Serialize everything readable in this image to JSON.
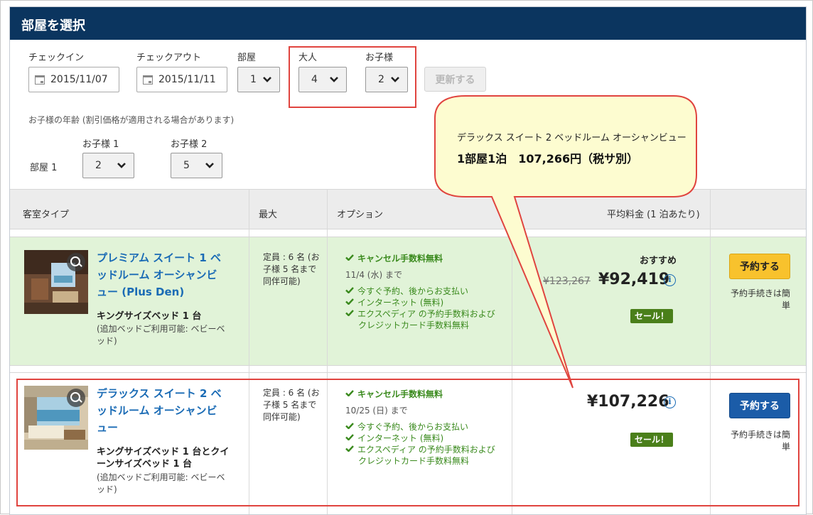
{
  "header": {
    "title": "部屋を選択"
  },
  "search": {
    "checkin_label": "チェックイン",
    "checkin_value": "2015/11/07",
    "checkout_label": "チェックアウト",
    "checkout_value": "2015/11/11",
    "rooms_label": "部屋",
    "rooms_value": "1",
    "adults_label": "大人",
    "adults_value": "4",
    "children_label": "お子様",
    "children_value": "2",
    "update_label": "更新する",
    "child_age_note": "お子様の年齢 (割引価格が適用される場合があります)",
    "room_label": "部屋 1",
    "child1_label": "お子様 1",
    "child1_value": "2",
    "child2_label": "お子様 2",
    "child2_value": "5"
  },
  "table": {
    "col_room_type": "客室タイプ",
    "col_max": "最大",
    "col_options": "オプション",
    "col_price": "平均料金 (1 泊あたり)"
  },
  "rooms": [
    {
      "title": "プレミアム スイート 1 ベッドルーム オーシャンビュー (Plus Den)",
      "bed": "キングサイズベッド 1 台",
      "extra_bed": "(追加ベッドご利用可能: ベビーベッド)",
      "capacity": "定員 : 6 名 (お子様 5 名まで同伴可能)",
      "opt_cancel": "キャンセル手数料無料",
      "opt_date": "11/4 (水) まで",
      "opt_pay": "今すぐ予約、後からお支払い",
      "opt_internet": "インターネット (無料)",
      "opt_fee": "エクスペディア の予約手数料およびクレジットカード手数料無料",
      "recommend": "おすすめ",
      "old_price": "¥123,267",
      "price": "¥92,419",
      "sale": "セール！",
      "book": "予約する",
      "simple": "予約手続きは簡単"
    },
    {
      "title": "デラックス スイート 2 ベッドルーム オーシャンビュー",
      "bed": "キングサイズベッド 1 台とクイーンサイズベッド 1 台",
      "extra_bed": "(追加ベッドご利用可能: ベビーベッド)",
      "capacity": "定員 : 6 名 (お子様 5 名まで同伴可能)",
      "opt_cancel": "キャンセル手数料無料",
      "opt_date": "10/25 (日) まで",
      "opt_pay": "今すぐ予約、後からお支払い",
      "opt_internet": "インターネット (無料)",
      "opt_fee": "エクスペディア の予約手数料およびクレジットカード手数料無料",
      "price": "¥107,226",
      "sale": "セール！",
      "book": "予約する",
      "simple": "予約手続きは簡単"
    }
  ],
  "callout": {
    "line1": "デラックス スイート 2 ベッドルーム オーシャンビュー",
    "line2": "1部屋1泊　107,266円（税サ別）"
  },
  "colors": {
    "header_bg": "#0b355f",
    "link_blue": "#1a6bb5",
    "option_green": "#3a8a1d",
    "row_highlight": "#e1f3d8",
    "sale_green": "#4a7f1a",
    "book_yellow": "#f8c22d",
    "book_blue": "#1b5ca8",
    "annotation_red": "#e0443f",
    "callout_fill": "#fdfcd0"
  },
  "icons": [
    "calendar-icon",
    "chevron-down-icon",
    "zoom-icon",
    "check-icon",
    "info-icon"
  ]
}
